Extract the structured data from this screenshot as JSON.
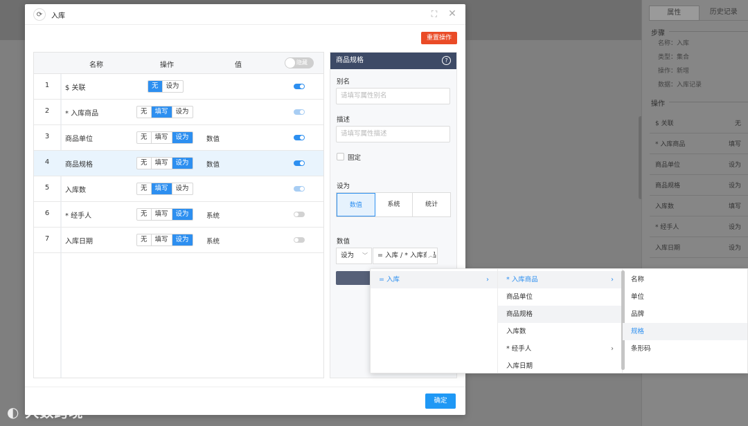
{
  "background": {
    "tabs": [
      "属性",
      "历史记录"
    ],
    "active_tab": 0,
    "steps_title": "步骤",
    "steps": [
      "名称：入库",
      "类型：集合",
      "操作：新增",
      "数据：入库记录"
    ],
    "ops_title": "操作",
    "ops": [
      {
        "name": "$ 关联",
        "value": "无"
      },
      {
        "name": "* 入库商品",
        "value": "填写"
      },
      {
        "name": "商品单位",
        "value": "设为"
      },
      {
        "name": "商品规格",
        "value": "设为"
      },
      {
        "name": "入库数",
        "value": "填写"
      },
      {
        "name": "* 经手人",
        "value": "设为"
      },
      {
        "name": "入库日期",
        "value": "设为"
      }
    ]
  },
  "modal": {
    "title": "入库",
    "refresh_icon": "refresh-icon",
    "expand_icon": "expand-icon",
    "close_icon": "close-icon",
    "reset_label": "重置操作",
    "confirm_label": "确定"
  },
  "table": {
    "headers": {
      "name": "名称",
      "op": "操作",
      "value": "值"
    },
    "hide_toggle_label": "隐藏",
    "rows": [
      {
        "idx": "1",
        "name": "$ 关联",
        "options": [
          "无",
          "设为"
        ],
        "selected": "无",
        "value": "",
        "toggle": "on"
      },
      {
        "idx": "2",
        "name": "* 入库商品",
        "options": [
          "无",
          "填写",
          "设为"
        ],
        "selected": "填写",
        "value": "",
        "toggle": "light"
      },
      {
        "idx": "3",
        "name": "商品单位",
        "options": [
          "无",
          "填写",
          "设为"
        ],
        "selected": "设为",
        "value": "数值",
        "toggle": "on"
      },
      {
        "idx": "4",
        "name": "商品规格",
        "options": [
          "无",
          "填写",
          "设为"
        ],
        "selected": "设为",
        "value": "数值",
        "toggle": "on"
      },
      {
        "idx": "5",
        "name": "入库数",
        "options": [
          "无",
          "填写",
          "设为"
        ],
        "selected": "填写",
        "value": "",
        "toggle": "light"
      },
      {
        "idx": "6",
        "name": "* 经手人",
        "options": [
          "无",
          "填写",
          "设为"
        ],
        "selected": "设为",
        "value": "系统",
        "toggle": "off"
      },
      {
        "idx": "7",
        "name": "入库日期",
        "options": [
          "无",
          "填写",
          "设为"
        ],
        "selected": "设为",
        "value": "系统",
        "toggle": "off"
      }
    ]
  },
  "panel": {
    "title": "商品规格",
    "alias_label": "别名",
    "alias_placeholder": "请填写属性别名",
    "desc_label": "描述",
    "desc_placeholder": "请填写属性描述",
    "fixed_label": "固定",
    "setas_label": "设为",
    "modes": [
      "数值",
      "系统",
      "统计"
    ],
    "active_mode": "数值",
    "value_label": "数值",
    "value_mode": "设为",
    "value_path": "= 入库 / * 入库商品"
  },
  "cascader": {
    "col1": [
      {
        "label": "= 入库",
        "has_children": true,
        "selected": true
      }
    ],
    "col2": [
      {
        "label": "* 入库商品",
        "has_children": true,
        "selected": true
      },
      {
        "label": "商品单位",
        "has_children": false
      },
      {
        "label": "商品规格",
        "has_children": false,
        "hover": true
      },
      {
        "label": "入库数",
        "has_children": false
      },
      {
        "label": "* 经手人",
        "has_children": true
      },
      {
        "label": "入库日期",
        "has_children": false
      }
    ],
    "col3": [
      {
        "label": "名称"
      },
      {
        "label": "单位"
      },
      {
        "label": "品牌"
      },
      {
        "label": "规格",
        "selected": true
      },
      {
        "label": "条形码"
      }
    ]
  },
  "watermark": "大数跨境",
  "colors": {
    "primary": "#2d8ff0",
    "danger": "#ea4b27",
    "panel_header": "#3d4a66",
    "confirm": "#1f98f5"
  }
}
